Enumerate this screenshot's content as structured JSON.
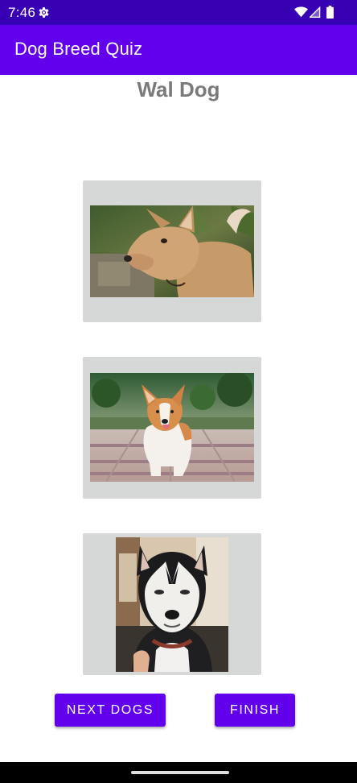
{
  "status_bar": {
    "time": "7:46",
    "icons": [
      "settings-gear-icon",
      "wifi-icon",
      "cell-signal-icon",
      "battery-icon"
    ]
  },
  "app_bar": {
    "title": "Dog Breed Quiz"
  },
  "quiz": {
    "breed_name": "Wal Dog",
    "dog_options": [
      {
        "image": "tan-mixed-breed-dog-photo"
      },
      {
        "image": "corgi-photo"
      },
      {
        "image": "husky-photo"
      }
    ]
  },
  "buttons": {
    "next_label": "NEXT DOGS",
    "finish_label": "FINISH"
  },
  "colors": {
    "status_bar": "#3700b3",
    "app_bar": "#6200ee",
    "button": "#6200ee",
    "card": "#d6d7d7",
    "breed_text": "#7a7a7a"
  }
}
